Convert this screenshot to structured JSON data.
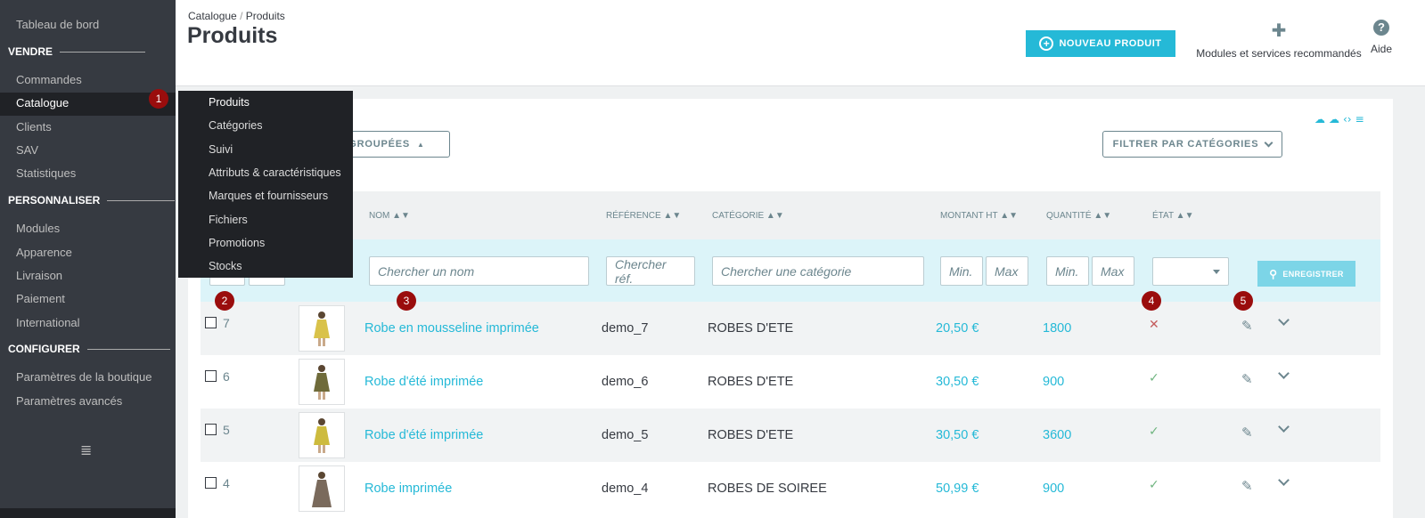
{
  "sidebar": {
    "items": [
      {
        "label": "Tableau de bord"
      },
      {
        "label": "Commandes"
      },
      {
        "label": "Catalogue"
      },
      {
        "label": "Clients"
      },
      {
        "label": "SAV"
      },
      {
        "label": "Statistiques"
      },
      {
        "label": "Modules"
      },
      {
        "label": "Apparence"
      },
      {
        "label": "Livraison"
      },
      {
        "label": "Paiement"
      },
      {
        "label": "International"
      },
      {
        "label": "Paramètres de la boutique"
      },
      {
        "label": "Paramètres avancés"
      }
    ],
    "sections": [
      "VENDRE",
      "PERSONNALISER",
      "CONFIGURER"
    ],
    "toggle_icon": "list-icon"
  },
  "submenu": [
    "Produits",
    "Catégories",
    "Suivi",
    "Attributs & caractéristiques",
    "Marques et fournisseurs",
    "Fichiers",
    "Promotions",
    "Stocks"
  ],
  "badges": [
    "1",
    "2",
    "3",
    "4",
    "5"
  ],
  "header": {
    "breadcrumb": [
      "Catalogue",
      "Produits"
    ],
    "breadcrumb_sep": "/",
    "title": "Produits",
    "new_product": "NOUVEAU PRODUIT",
    "modules": "Modules et services recommandés",
    "help": "Aide"
  },
  "toolbar": {
    "bulk_actions": "S GROUPÉES",
    "filter_categories": "FILTRER PAR CATÉGORIES"
  },
  "table": {
    "columns": {
      "name": "NOM ▲▼",
      "reference": "RÉFÉRENCE ▲▼",
      "category": "CATÉGORIE ▲▼",
      "price": "MONTANT HT ▲▼",
      "quantity": "QUANTITÉ ▲▼",
      "state": "ÉTAT ▲▼"
    },
    "filters": {
      "name": "Chercher un nom",
      "reference": "Chercher réf.",
      "category": "Chercher une catégorie",
      "price_min": "Min.",
      "price_max": "Max",
      "qty_min": "Min.",
      "qty_max": "Max",
      "save": "ENREGISTRER"
    },
    "rows": [
      {
        "id": "7",
        "name": "Robe en mousseline imprimée",
        "ref": "demo_7",
        "category": "ROBES D'ETE",
        "price": "20,50 €",
        "qty": "1800",
        "state": "✕",
        "active": false
      },
      {
        "id": "6",
        "name": "Robe d'été imprimée",
        "ref": "demo_6",
        "category": "ROBES D'ETE",
        "price": "30,50 €",
        "qty": "900",
        "state": "✓",
        "active": true
      },
      {
        "id": "5",
        "name": "Robe d'été imprimée",
        "ref": "demo_5",
        "category": "ROBES D'ETE",
        "price": "30,50 €",
        "qty": "3600",
        "state": "✓",
        "active": true
      },
      {
        "id": "4",
        "name": "Robe imprimée",
        "ref": "demo_4",
        "category": "ROBES DE SOIREE",
        "price": "50,99 €",
        "qty": "900",
        "state": "✓",
        "active": true
      }
    ]
  },
  "colors": {
    "accent": "#25b9d7",
    "sidebar": "#363a41",
    "badge": "#9a0d0d",
    "active_state": "#70b580",
    "inactive_state": "#c45c5c"
  }
}
